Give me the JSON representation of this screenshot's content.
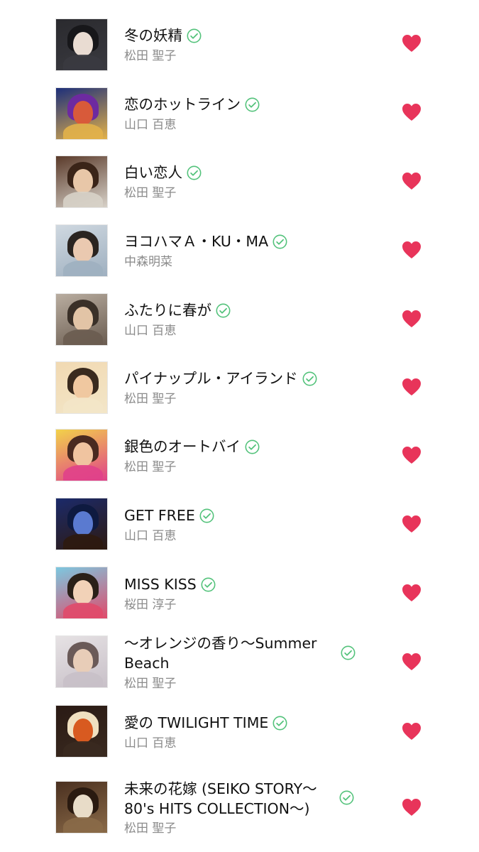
{
  "songs": [
    {
      "title": "冬の妖精",
      "artist": "松田 聖子",
      "status_icon": "downloaded-check-icon",
      "liked_icon": "heart-icon",
      "art_colors": [
        "#2a2a2e",
        "#e9dcd2",
        "#17171a",
        "#3a3a40"
      ]
    },
    {
      "title": "恋のホットライン",
      "artist": "山口 百恵",
      "status_icon": "downloaded-check-icon",
      "liked_icon": "heart-icon",
      "art_colors": [
        "#1d2f7a",
        "#d85a3a",
        "#6d2aa0",
        "#e2b14a"
      ]
    },
    {
      "title": "白い恋人",
      "artist": "松田 聖子",
      "status_icon": "downloaded-check-icon",
      "liked_icon": "heart-icon",
      "art_colors": [
        "#5a3a2a",
        "#e8c7a8",
        "#3a2418",
        "#d7d1c8"
      ]
    },
    {
      "title": "ヨコハマＡ・KU・MA",
      "artist": "中森明菜",
      "status_icon": "downloaded-check-icon",
      "liked_icon": "heart-icon",
      "art_colors": [
        "#cfd8e0",
        "#eac9b0",
        "#2a2420",
        "#9fb0c0"
      ]
    },
    {
      "title": "ふたりに春が",
      "artist": "山口 百恵",
      "status_icon": "downloaded-check-icon",
      "liked_icon": "heart-icon",
      "art_colors": [
        "#b9ada0",
        "#e2c4a6",
        "#3a3028",
        "#6a5c50"
      ]
    },
    {
      "title": "パイナップル・アイランド",
      "artist": "松田 聖子",
      "status_icon": "downloaded-check-icon",
      "liked_icon": "heart-icon",
      "art_colors": [
        "#f1d9b2",
        "#f0c8a0",
        "#3a2a1e",
        "#f3e6c8"
      ]
    },
    {
      "title": "銀色のオートバイ",
      "artist": "松田 聖子",
      "status_icon": "downloaded-check-icon",
      "liked_icon": "heart-icon",
      "art_colors": [
        "#f2d24a",
        "#f0c4a0",
        "#4a2a20",
        "#e0418a"
      ]
    },
    {
      "title": "GET FREE",
      "artist": "山口 百恵",
      "status_icon": "downloaded-check-icon",
      "liked_icon": "heart-icon",
      "art_colors": [
        "#1b2a6a",
        "#5a7ad0",
        "#0e1a40",
        "#2e1a10"
      ]
    },
    {
      "title": "MISS KISS",
      "artist": "桜田 淳子",
      "status_icon": "downloaded-check-icon",
      "liked_icon": "heart-icon",
      "art_colors": [
        "#7cc8e0",
        "#f2d2b8",
        "#2a2018",
        "#e04a6a"
      ]
    },
    {
      "title": "〜オレンジの香り〜Summer Beach",
      "artist": "松田 聖子",
      "status_icon": "downloaded-check-icon",
      "liked_icon": "heart-icon",
      "art_colors": [
        "#e6e2e4",
        "#e8cdb8",
        "#6a5a58",
        "#c8c0c8"
      ]
    },
    {
      "title": "愛の TWILIGHT TIME",
      "artist": "山口 百恵",
      "status_icon": "downloaded-check-icon",
      "liked_icon": "heart-icon",
      "art_colors": [
        "#2a1a14",
        "#d85a20",
        "#f0e0c0",
        "#3a2a20"
      ]
    },
    {
      "title": "未来の花嫁 (SEIKO STORY〜80's HITS COLLECTION〜)",
      "artist": "松田 聖子",
      "status_icon": "downloaded-check-icon",
      "liked_icon": "heart-icon",
      "art_colors": [
        "#4a3020",
        "#e8dcc8",
        "#2a1a10",
        "#8a6a48"
      ]
    }
  ],
  "colors": {
    "heart": "#e8345a",
    "check": "#52c27a",
    "artist_text": "#8a8a8a",
    "title_text": "#111111"
  }
}
